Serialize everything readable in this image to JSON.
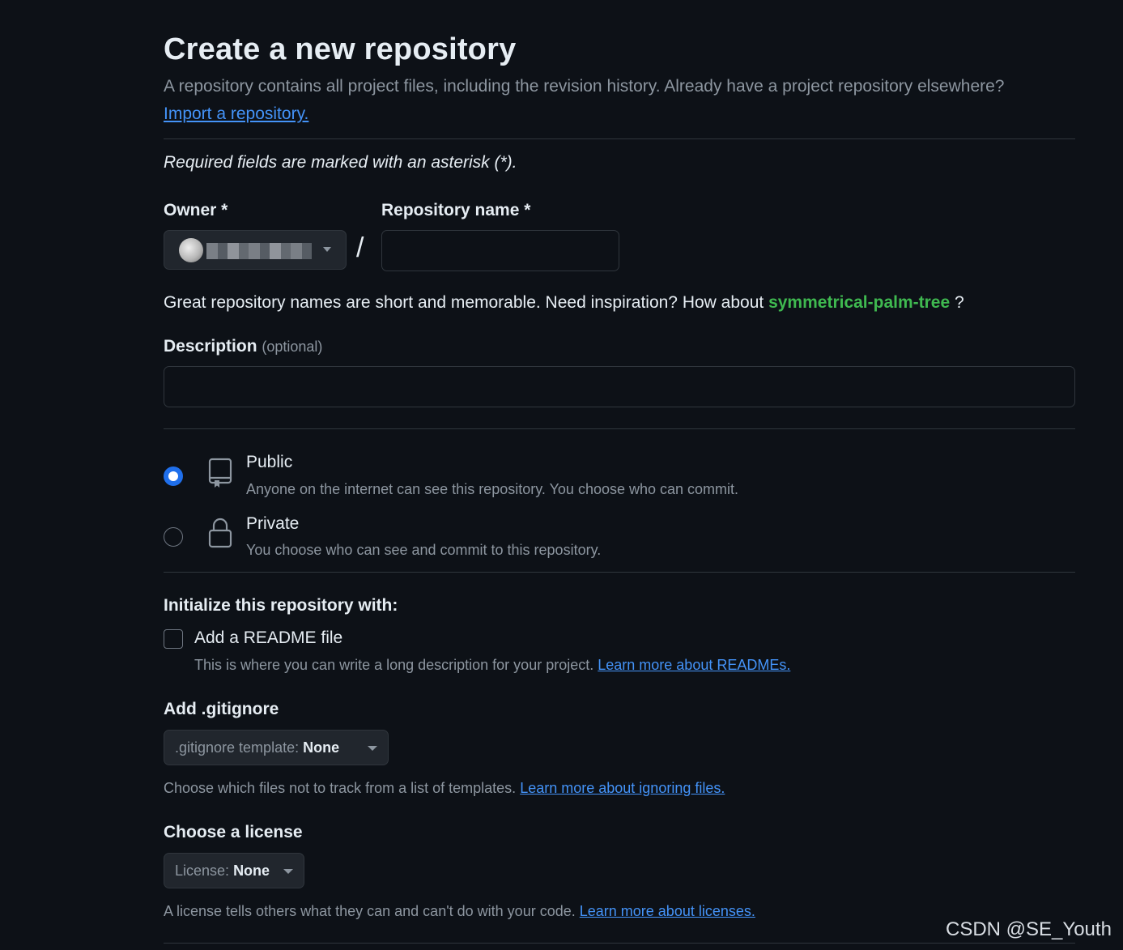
{
  "header": {
    "title": "Create a new repository",
    "subtitle": "A repository contains all project files, including the revision history. Already have a project repository elsewhere?",
    "import_link": "Import a repository."
  },
  "required_note": "Required fields are marked with an asterisk (*).",
  "owner": {
    "label": "Owner *",
    "avatar_icon": "user-avatar-icon",
    "caret_icon": "triangle-down-icon"
  },
  "separator": "/",
  "repo_name": {
    "label": "Repository name *",
    "value": ""
  },
  "name_hint": {
    "text": "Great repository names are short and memorable. Need inspiration? How about",
    "suggestion": "symmetrical-palm-tree",
    "suffix": "?"
  },
  "description": {
    "label": "Description",
    "optional": "(optional)",
    "value": ""
  },
  "visibility": {
    "selected": "public",
    "options": [
      {
        "id": "public",
        "title": "Public",
        "desc": "Anyone on the internet can see this repository. You choose who can commit.",
        "icon": "repo-icon"
      },
      {
        "id": "private",
        "title": "Private",
        "desc": "You choose who can see and commit to this repository.",
        "icon": "lock-icon"
      }
    ]
  },
  "initialize": {
    "label": "Initialize this repository with:",
    "readme": {
      "label": "Add a README file",
      "checked": false,
      "help": "This is where you can write a long description for your project.",
      "link": "Learn more about READMEs."
    }
  },
  "gitignore": {
    "label": "Add .gitignore",
    "button_prefix": ".gitignore template:",
    "button_value": "None",
    "help": "Choose which files not to track from a list of templates.",
    "link": "Learn more about ignoring files."
  },
  "license": {
    "label": "Choose a license",
    "button_prefix": "License:",
    "button_value": "None",
    "help": "A license tells others what they can and can't do with your code.",
    "link": "Learn more about licenses."
  },
  "watermark": "CSDN @SE_Youth",
  "colors": {
    "background": "#0d1117",
    "accent_blue": "#1f6feb",
    "link": "#4493f8",
    "suggestion_green": "#3fb950",
    "muted": "#8d96a0",
    "border": "#30363d"
  }
}
